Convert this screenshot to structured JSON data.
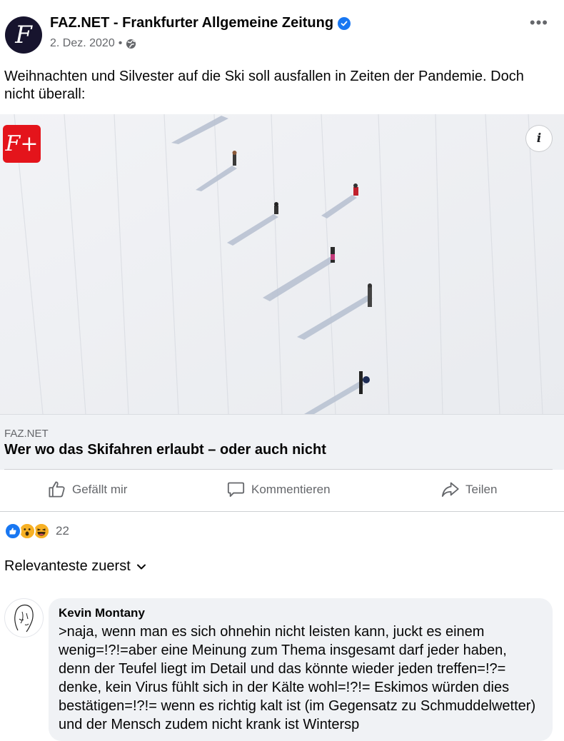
{
  "post": {
    "page_name": "FAZ.NET - Frankfurter Allgemeine Zeitung",
    "page_logo_letter": "F",
    "date": "2. Dez. 2020",
    "separator": "•",
    "more_label": "•••",
    "text": "Weihnachten und Silvester auf die Ski soll ausfallen in Zeiten der Pandemie. Doch nicht überall:"
  },
  "media": {
    "badge": "F+",
    "info_label": "i"
  },
  "link": {
    "domain": "FAZ.NET",
    "title": "Wer wo das Skifahren erlaubt – oder auch nicht"
  },
  "actions": {
    "like": "Gefällt mir",
    "comment": "Kommentieren",
    "share": "Teilen"
  },
  "reactions": {
    "icons": [
      "like-icon",
      "wow-icon",
      "haha-icon"
    ],
    "count": "22"
  },
  "sort": {
    "label": "Relevanteste zuerst"
  },
  "comment": {
    "author": "Kevin Montany",
    "text": ">naja, wenn man es sich ohnehin nicht leisten kann, juckt es einem wenig=!?!=aber eine Meinung zum Thema insgesamt darf jeder haben, denn der Teufel liegt im Detail und das könnte wieder jeden treffen=!?= denke, kein Virus fühlt sich in der Kälte wohl=!?!= Eskimos würden dies bestätigen=!?!= wenn es richtig kalt ist (im Gegensatz zu Schmuddelwetter) und der Mensch zudem nicht krank ist Wintersp"
  },
  "colors": {
    "brand_blue": "#1877f2",
    "faz_red": "#e4141b",
    "faz_navy": "#17142e",
    "secondary_text": "#65676b"
  }
}
